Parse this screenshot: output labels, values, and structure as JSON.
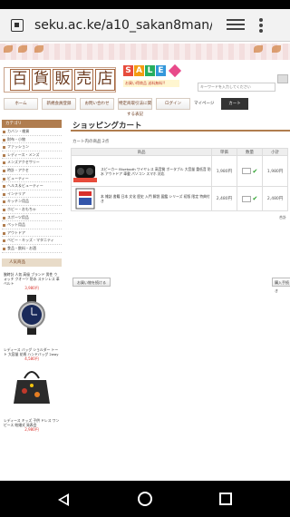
{
  "browser": {
    "url": "seku.ac.ke/a10_sakan8man/b",
    "icons": [
      "page-icon",
      "tabs-icon",
      "overflow-menu-icon"
    ]
  },
  "header": {
    "logo_chars": [
      "百",
      "貨",
      "販",
      "売",
      "店"
    ],
    "sale_letters": [
      "S",
      "A",
      "L",
      "E"
    ],
    "sale_colors": [
      "#e74c3c",
      "#f39c12",
      "#27ae60",
      "#3498db"
    ],
    "sale_sub": "お買い得商品 送料無料!!",
    "search_placeholder": "キーワードを入力してください"
  },
  "nav": {
    "items": [
      "ホーム",
      "新規会員登録",
      "お問い合わせ",
      "特定商取引法に関する表記",
      "ログイン"
    ],
    "mypage": "マイページ",
    "cart": "カート"
  },
  "sidebar": {
    "category_title": "カテゴリ",
    "categories": [
      "カバン・雑貨",
      "財布・小物",
      "ファッション",
      "レディース・メンズ",
      "メンズアクセサリー",
      "時計・アクセ",
      "ビューティー",
      "ヘルス＆ビューティー",
      "インテリア",
      "キッチン用品",
      "ホビー・おもちゃ",
      "スポーツ用品",
      "ペット用品",
      "アウトドア",
      "ベビー・キッズ・マタニティ",
      "食品・飲料・お酒"
    ],
    "ranking_title": "人気商品",
    "products": [
      {
        "name": "腕時計 人気 高級 ブランド 男性 ウォッチ クオーツ 防水 ステンレス 革ベルト",
        "price": "3,980円"
      },
      {
        "name": "レディース バッグ ショルダー トート 大容量 花柄 ハンドバッグ 2way",
        "price": "4,580円"
      },
      {
        "name": "レディース キッズ 子供 ドレス ワンピース 結婚式 発表会",
        "price": "2,980円"
      }
    ]
  },
  "main": {
    "title": "ショッピングカート",
    "message": "カート内の商品 2点",
    "columns": [
      "商品",
      "単価",
      "数量",
      "小計"
    ],
    "rows": [
      {
        "desc": "スピーカー Bluetooth ワイヤレス 高音質 ポータブル 大音量 重低音 防水 アウトドア 車載 パソコン スマホ 対応",
        "price": "1,980円",
        "subtotal": "1,980円"
      },
      {
        "desc": "本 雑誌 書籍 日本 文化 歴史 入門 解説 図鑑 シリーズ 初版 限定 特典付き",
        "price": "2,480円",
        "subtotal": "2,480円"
      }
    ],
    "total_label": "合計",
    "continue_label": "お買い物を続ける",
    "next_label": "購入手続き"
  }
}
